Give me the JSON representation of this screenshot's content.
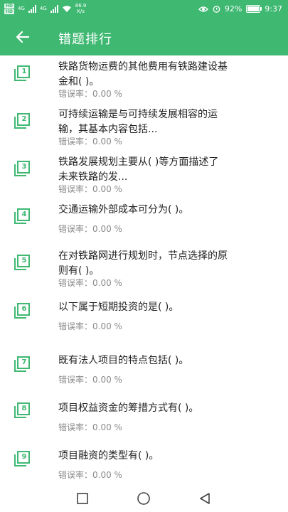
{
  "status": {
    "hd1": "HD",
    "hd2": "HD",
    "net1": "4G",
    "net2": "4G",
    "speed": "86.9",
    "speed_unit": "K/s",
    "battery": "92%",
    "time": "9:37"
  },
  "header": {
    "title": "错题排行"
  },
  "rate_label": "错误率：",
  "items": [
    {
      "num": "1",
      "q1": "铁路货物运费的其他费用有铁路建设基",
      "q2": "金和( )。",
      "rate": "0.00 %"
    },
    {
      "num": "2",
      "q1": "可持续运输是与可持续发展相容的运",
      "q2": "输，其基本内容包括...",
      "rate": "0.00 %"
    },
    {
      "num": "3",
      "q1": "铁路发展规划主要从( )等方面描述了",
      "q2": "未来铁路的发...",
      "rate": "0.00 %"
    },
    {
      "num": "4",
      "q1": "交通运输外部成本可分为( )。",
      "q2": "",
      "rate": "0.00 %"
    },
    {
      "num": "5",
      "q1": "在对铁路网进行规划时，节点选择的原",
      "q2": "则有( )。",
      "rate": "0.00 %"
    },
    {
      "num": "6",
      "q1": "以下属于短期投资的是( )。",
      "q2": "",
      "rate": "0.00 %"
    },
    {
      "num": "7",
      "q1": "既有法人项目的特点包括( )。",
      "q2": "",
      "rate": "0.00 %"
    },
    {
      "num": "8",
      "q1": "项目权益资金的筹措方式有( )。",
      "q2": "",
      "rate": "0.00 %"
    },
    {
      "num": "9",
      "q1": "项目融资的类型有( )。",
      "q2": "",
      "rate": "0.00 %"
    }
  ],
  "colors": {
    "accent": "#3fb872",
    "text": "#222222",
    "muted": "#8a8a8a"
  }
}
